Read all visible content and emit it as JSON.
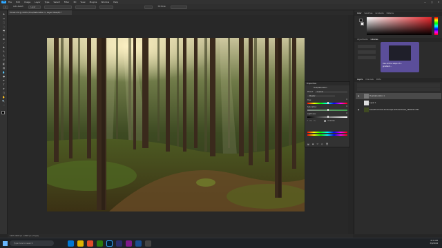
{
  "app": {
    "menus": [
      "File",
      "Edit",
      "Image",
      "Layer",
      "Type",
      "Select",
      "Filter",
      "3D",
      "View",
      "Plugins",
      "Window",
      "Help"
    ],
    "logo": "Ps",
    "window_controls": [
      "—",
      "▢",
      "✕"
    ]
  },
  "options_bar": {
    "items": [
      "▾",
      "Auto-Select:",
      "Layer",
      "",
      "",
      "",
      "",
      "3D Mode:",
      "",
      ""
    ]
  },
  "document": {
    "tab_title": "Forest #2 @ 100% (Hue/Saturation 1, Layer Mask/8) *"
  },
  "status_bar": {
    "text": "100%   4000 px x 2667 px (72 ppi)"
  },
  "properties_panel": {
    "title": "Properties",
    "subtitle": "Hue/Saturation",
    "preset_label": "Preset:",
    "preset_value": "Custom",
    "channel_value": "Master",
    "hue_label": "Hue:",
    "saturation_label": "Saturation:",
    "lightness_label": "Lightness:",
    "colorize_label": "Colorize",
    "hue_value": "0",
    "saturation_value": "0",
    "lightness_value": "0"
  },
  "right_panel": {
    "top_tabs": [
      "Color",
      "Swatches",
      "Gradients",
      "Patterns"
    ],
    "mid_tabs": [
      "Adjustments",
      "Libraries"
    ],
    "learn_card_lines": [
      "Use all the steps of a",
      "gradient..."
    ],
    "layers_tabs": [
      "Layers",
      "Channels",
      "Paths"
    ],
    "layers": [
      {
        "name": "Hue/Saturation 1",
        "type": "adjustment"
      },
      {
        "name": "Layer 1",
        "type": "layer"
      },
      {
        "name": "beautiful-forest-landscape-with-tall-trees_181624-1781",
        "type": "image"
      }
    ]
  },
  "taskbar": {
    "search_placeholder": "Type here to search",
    "tray_time": "8:35 PM",
    "tray_date": "3/3/2024"
  },
  "colors": {
    "accent": "#31a8ff",
    "panel": "#323232",
    "canvas_bg": "#282828"
  }
}
